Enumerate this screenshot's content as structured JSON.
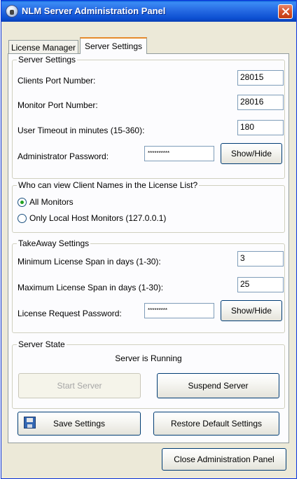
{
  "window": {
    "title": "NLM Server Administration Panel"
  },
  "tabs": [
    {
      "label": "License Manager",
      "active": false
    },
    {
      "label": "Server Settings",
      "active": true
    }
  ],
  "server_settings": {
    "title": "Server Settings",
    "clients_port_label": "Clients Port Number:",
    "clients_port_value": "28015",
    "monitor_port_label": "Monitor Port Number:",
    "monitor_port_value": "28016",
    "timeout_label": "User Timeout in minutes (15-360):",
    "timeout_value": "180",
    "admin_pwd_label": "Administrator Password:",
    "admin_pwd_value": "**********",
    "showhide_label": "Show/Hide"
  },
  "client_names": {
    "title": "Who can view Client Names in the License List?",
    "options": [
      {
        "label": "All Monitors",
        "checked": true
      },
      {
        "label": "Only Local Host Monitors (127.0.0.1)",
        "checked": false
      }
    ]
  },
  "takeaway": {
    "title": "TakeAway Settings",
    "min_span_label": "Minimum License Span in days (1-30):",
    "min_span_value": "3",
    "max_span_label": "Maximum License Span in days (1-30):",
    "max_span_value": "25",
    "request_pwd_label": "License Request Password:",
    "request_pwd_value": "*********",
    "showhide_label": "Show/Hide"
  },
  "server_state": {
    "title": "Server State",
    "status": "Server is Running",
    "start_label": "Start Server",
    "suspend_label": "Suspend Server"
  },
  "actions": {
    "save_label": "Save Settings",
    "restore_label": "Restore Default Settings",
    "close_label": "Close Administration Panel"
  }
}
